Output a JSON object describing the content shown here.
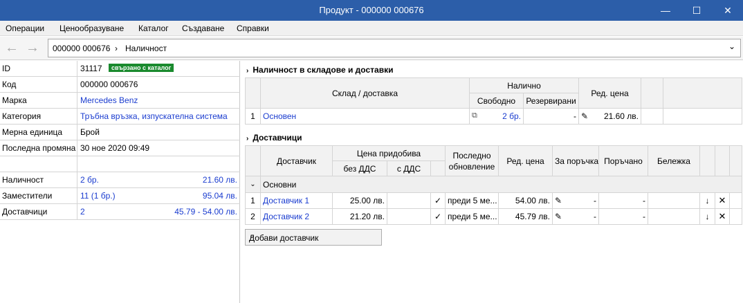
{
  "window": {
    "title": "Продукт - 000000 000676",
    "minimize": "—",
    "maximize": "☐",
    "close": "✕"
  },
  "menu": [
    "Операции",
    "Ценообразуване",
    "Каталог",
    "Създаване",
    "Справки"
  ],
  "nav": {
    "back": "←",
    "forward": "→",
    "crumb_product": "000000 000676",
    "crumb_sep": "›",
    "crumb_page": "Наличност",
    "dropdown": "⌄"
  },
  "props": {
    "id": {
      "label": "ID",
      "value": "31117",
      "badge": "свързано с каталог"
    },
    "code": {
      "label": "Код",
      "value": "000000 000676"
    },
    "brand": {
      "label": "Марка",
      "value": "Mercedes Benz"
    },
    "category": {
      "label": "Категория",
      "value": "Тръбна връзка, изпускателна система"
    },
    "unit": {
      "label": "Мерна единица",
      "value": "Брой"
    },
    "modified": {
      "label": "Последна промяна",
      "value": "30 ное 2020 09:49"
    },
    "stock": {
      "label": "Наличност",
      "value": "2 бр.",
      "amount": "21.60 лв."
    },
    "substitutes": {
      "label": "Заместители",
      "value": "11 (1 бр.)",
      "amount": "95.04 лв."
    },
    "suppliers": {
      "label": "Доставчици",
      "value": "2",
      "amount": "45.79 - 54.00 лв."
    }
  },
  "stock_section": {
    "title": "Наличност в складове и доставки",
    "headers": {
      "warehouse": "Склад / доставка",
      "available": "Налично",
      "free": "Свободно",
      "reserved": "Резервирани",
      "price": "Ред. цена"
    },
    "rows": [
      {
        "num": "1",
        "warehouse": "Основен",
        "free": "2 бр.",
        "reserved": "-",
        "price": "21.60 лв."
      }
    ]
  },
  "suppliers_section": {
    "title": "Доставчици",
    "headers": {
      "supplier": "Доставчик",
      "cost": "Цена придобива",
      "no_vat": "без ДДС",
      "with_vat": "с ДДС",
      "last_update": "Последно обновление",
      "last_update_1": "Последно",
      "last_update_2": "обновление",
      "price": "Ред. цена",
      "to_order": "За поръчка",
      "ordered": "Поръчано",
      "note": "Бележка"
    },
    "group": "Основни",
    "rows": [
      {
        "num": "1",
        "supplier": "Доставчик 1",
        "no_vat": "25.00 лв.",
        "with_vat": "",
        "check": "✓",
        "last_update": "преди 5 ме...",
        "price": "54.00 лв.",
        "to_order": "-",
        "ordered": "-",
        "note": ""
      },
      {
        "num": "2",
        "supplier": "Доставчик 2",
        "no_vat": "21.20 лв.",
        "with_vat": "",
        "check": "✓",
        "last_update": "преди 5 ме...",
        "price": "45.79 лв.",
        "to_order": "-",
        "ordered": "-",
        "note": ""
      }
    ],
    "add_button": "Добави доставчик"
  },
  "colors": {
    "titlebar": "#2c5ea9",
    "link": "#1a3ccf",
    "badge": "#1a8a2e"
  }
}
